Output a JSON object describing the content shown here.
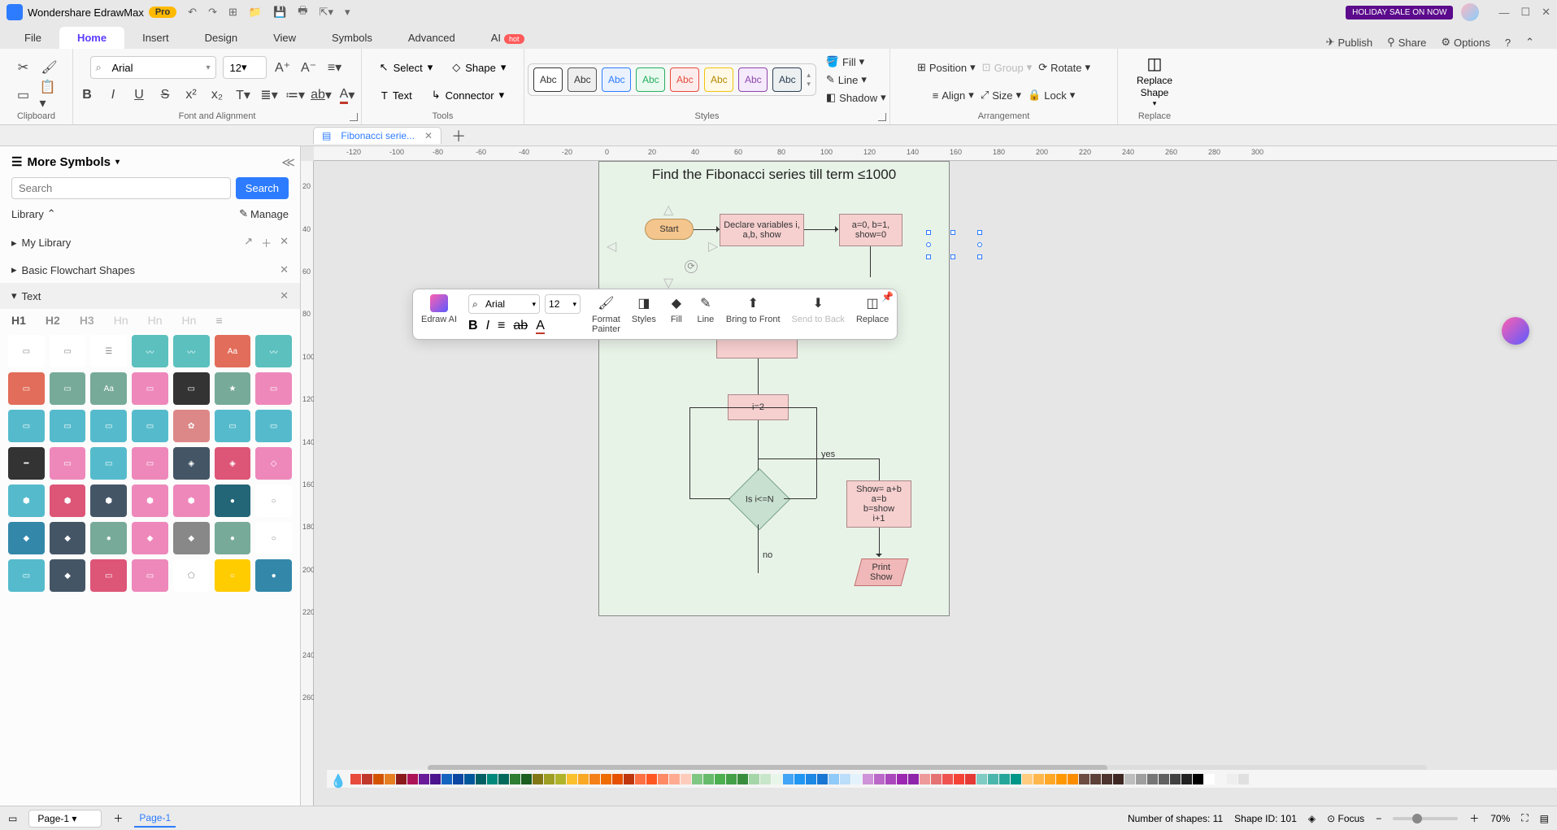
{
  "app": {
    "name": "Wondershare EdrawMax",
    "pro": "Pro",
    "holiday": "HOLIDAY SALE ON NOW"
  },
  "menu": {
    "items": [
      "File",
      "Home",
      "Insert",
      "Design",
      "View",
      "Symbols",
      "Advanced",
      "AI"
    ],
    "active": "Home",
    "hot": "hot",
    "right": {
      "publish": "Publish",
      "share": "Share",
      "options": "Options"
    }
  },
  "ribbon": {
    "clipboard": {
      "label": "Clipboard"
    },
    "font": {
      "label": "Font and Alignment",
      "font_name": "Arial",
      "font_size": "12"
    },
    "tools": {
      "label": "Tools",
      "select": "Select",
      "shape": "Shape",
      "text": "Text",
      "connector": "Connector"
    },
    "styles": {
      "label": "Styles",
      "abc": "Abc",
      "fill": "Fill",
      "line": "Line",
      "shadow": "Shadow"
    },
    "arrangement": {
      "label": "Arrangement",
      "position": "Position",
      "group": "Group",
      "rotate": "Rotate",
      "align": "Align",
      "size": "Size",
      "lock": "Lock"
    },
    "replace": {
      "label": "Replace",
      "title1": "Replace",
      "title2": "Shape"
    }
  },
  "tabs": {
    "file": "Fibonacci serie..."
  },
  "left": {
    "title": "More Symbols",
    "search_ph": "Search",
    "search_btn": "Search",
    "library": "Library",
    "manage": "Manage",
    "mylib": "My Library",
    "basic": "Basic Flowchart Shapes",
    "text": "Text",
    "h1": "H1",
    "h2": "H2",
    "h3": "H3"
  },
  "diagram": {
    "title": "Find the Fibonacci series till term ≤1000",
    "start": "Start",
    "declare": "Declare variables i, a,b, show",
    "init": "a=0, b=1,\nshow=0",
    "i2": "i=2",
    "dec": "Is i<=N",
    "calc": "Show= a+b\na=b\nb=show\ni+1",
    "print": "Print\nShow",
    "yes": "yes",
    "no": "no"
  },
  "floatbar": {
    "ai": "Edraw AI",
    "font": "Arial",
    "size": "12",
    "format": "Format\nPainter",
    "styles": "Styles",
    "fill": "Fill",
    "line": "Line",
    "bring": "Bring to Front",
    "send": "Send to Back",
    "replace": "Replace"
  },
  "status": {
    "page_sel": "Page-1",
    "page_tab": "Page-1",
    "shapes": "Number of shapes: 11",
    "shape_id": "Shape ID: 101",
    "focus": "Focus",
    "zoom": "70%"
  },
  "colors": [
    "#e74c3c",
    "#c0392b",
    "#d35400",
    "#e67e22",
    "#8b1a1a",
    "#ad1457",
    "#6a1b9a",
    "#4a148c",
    "#1565c0",
    "#0d47a1",
    "#01579b",
    "#006064",
    "#00897b",
    "#00695c",
    "#2e7d32",
    "#1b5e20",
    "#827717",
    "#9e9d24",
    "#afb42b",
    "#fbc02d",
    "#f9a825",
    "#f57f17",
    "#ef6c00",
    "#e65100",
    "#bf360c",
    "#ff7043",
    "#ff5722",
    "#ff8a65",
    "#ffab91",
    "#ffccbc",
    "#81c784",
    "#66bb6a",
    "#4caf50",
    "#43a047",
    "#388e3c",
    "#a5d6a7",
    "#c8e6c9",
    "#e8f5e9",
    "#42a5f5",
    "#2196f3",
    "#1e88e5",
    "#1976d2",
    "#90caf9",
    "#bbdefb",
    "#e3f2fd",
    "#ce93d8",
    "#ba68c8",
    "#ab47bc",
    "#9c27b0",
    "#8e24aa",
    "#ef9a9a",
    "#e57373",
    "#ef5350",
    "#f44336",
    "#e53935",
    "#80cbc4",
    "#4db6ac",
    "#26a69a",
    "#009688",
    "#ffcc80",
    "#ffb74d",
    "#ffa726",
    "#ff9800",
    "#fb8c00",
    "#6d4c41",
    "#5d4037",
    "#4e342e",
    "#3e2723",
    "#bdbdbd",
    "#9e9e9e",
    "#757575",
    "#616161",
    "#424242",
    "#212121",
    "#000000",
    "#ffffff",
    "#f5f5f5",
    "#eeeeee",
    "#e0e0e0"
  ]
}
